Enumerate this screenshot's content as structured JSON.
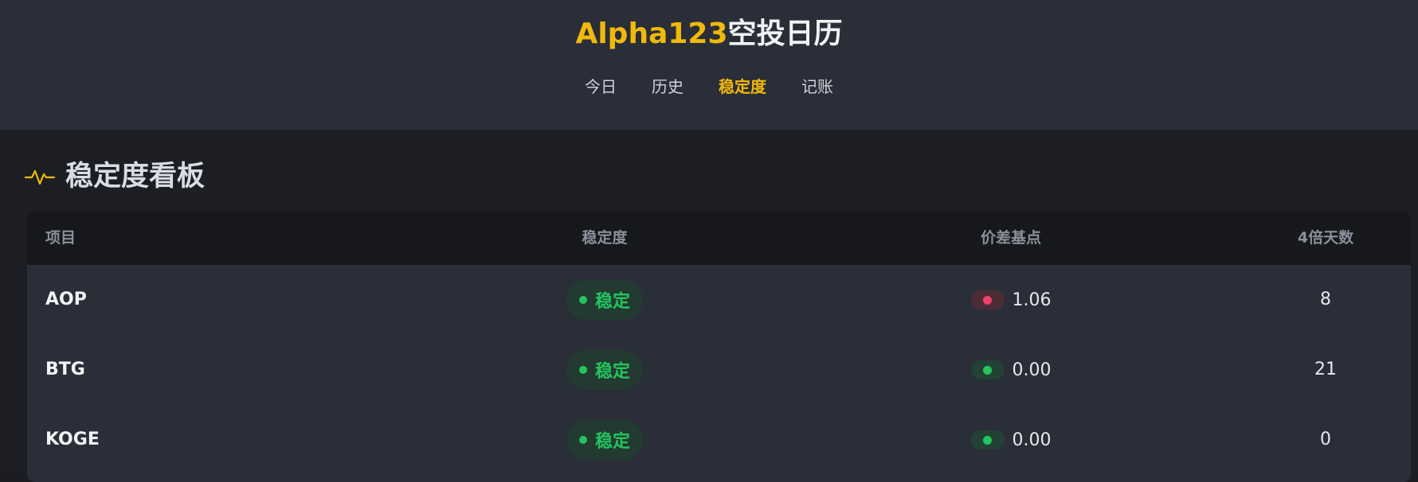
{
  "header": {
    "title_brand": "Alpha123",
    "title_rest": "空投日历",
    "nav": [
      {
        "label": "今日",
        "active": false
      },
      {
        "label": "历史",
        "active": false
      },
      {
        "label": "稳定度",
        "active": true
      },
      {
        "label": "记账",
        "active": false
      }
    ]
  },
  "section": {
    "icon": "pulse-icon",
    "title": "稳定度看板"
  },
  "table": {
    "columns": [
      "项目",
      "稳定度",
      "价差基点",
      "4倍天数"
    ],
    "rows": [
      {
        "name": "AOP",
        "stability": "稳定",
        "spread_indicator": "red",
        "spread": "1.06",
        "days": "8"
      },
      {
        "name": "BTG",
        "stability": "稳定",
        "spread_indicator": "green",
        "spread": "0.00",
        "days": "21"
      },
      {
        "name": "KOGE",
        "stability": "稳定",
        "spread_indicator": "green",
        "spread": "0.00",
        "days": "0"
      }
    ]
  },
  "colors": {
    "accent": "#f0b90b",
    "stable_green": "#22c55e",
    "alert_red": "#f0436a"
  }
}
